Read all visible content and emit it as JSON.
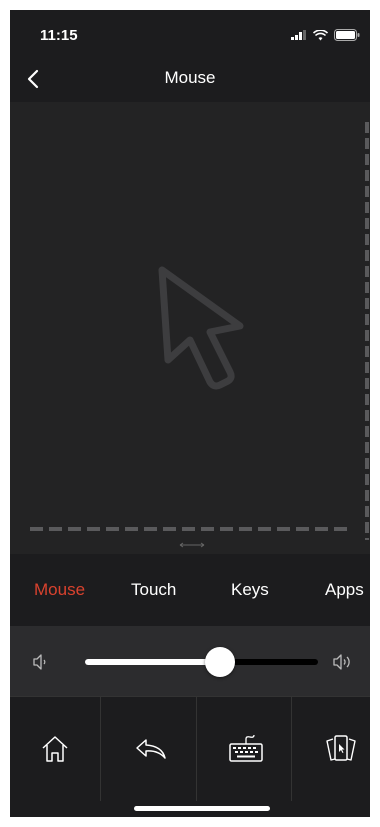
{
  "status": {
    "time": "11:15"
  },
  "nav": {
    "title": "Mouse"
  },
  "tabs": [
    {
      "label": "Mouse",
      "active": true
    },
    {
      "label": "Touch",
      "active": false
    },
    {
      "label": "Keys",
      "active": false
    },
    {
      "label": "Apps",
      "active": false
    }
  ],
  "volume": {
    "level": 0.58
  },
  "bottom_buttons": [
    "home-icon",
    "back-arrow-icon",
    "keyboard-icon",
    "app-switch-icon"
  ],
  "colors": {
    "accent": "#d9422e",
    "background": "#1c1c1e",
    "touchpad": "#232324"
  }
}
